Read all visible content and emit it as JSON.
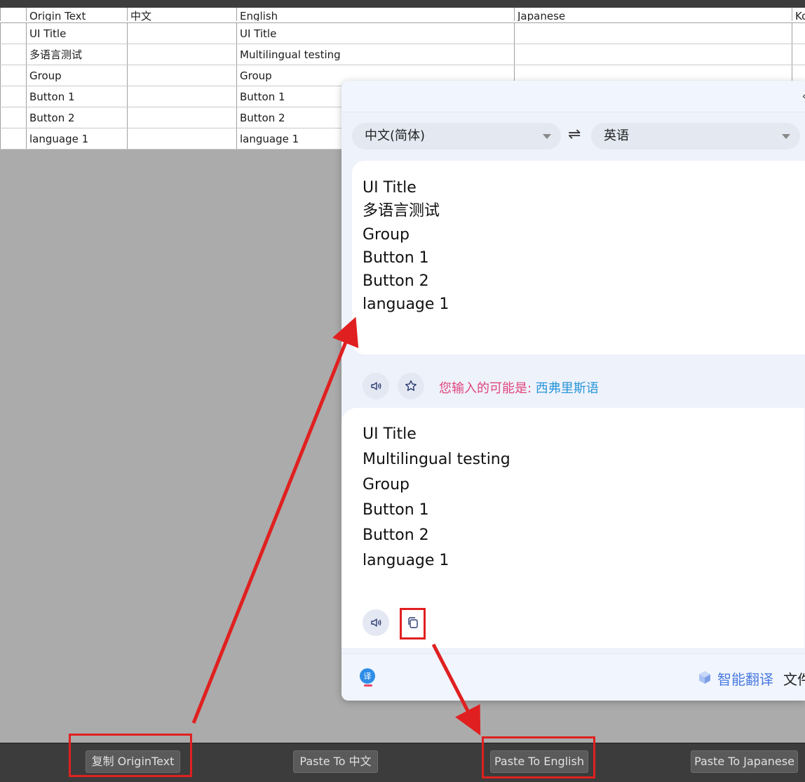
{
  "grid": {
    "headers": [
      "",
      "Origin Text",
      "中文",
      "English",
      "Japanese",
      "Ko"
    ],
    "rows": [
      [
        "",
        "UI Title",
        "",
        "UI Title",
        "",
        ""
      ],
      [
        "",
        "多语言测试",
        "",
        "Multilingual testing",
        "",
        ""
      ],
      [
        "",
        "Group",
        "",
        "Group",
        "",
        ""
      ],
      [
        "",
        "Button 1",
        "",
        "Button 1",
        "",
        ""
      ],
      [
        "",
        "Button 2",
        "",
        "Button 2",
        "",
        ""
      ],
      [
        "",
        "language 1",
        "",
        "language 1",
        "",
        ""
      ]
    ]
  },
  "translator": {
    "close_glyph": "‹",
    "source_lang": "中文(简体)",
    "swap_glyph": "⇌",
    "target_lang": "英语",
    "source_lines": [
      "UI Title",
      "多语言测试",
      "Group",
      "Button 1",
      "Button 2",
      "language 1"
    ],
    "hint_prefix": "您输入的可能是: ",
    "hint_link": "西弗里斯语",
    "target_lines": [
      "UI Title",
      "Multilingual testing",
      "Group",
      "Button 1",
      "Button 2",
      "language 1"
    ],
    "footer_smart": "智能翻译",
    "footer_doc": "文件",
    "colors": {
      "hint": "#e0457b",
      "link": "#2a97d8",
      "smart": "#4a7be0"
    },
    "icons": [
      "speaker-icon",
      "star-icon",
      "copy-icon",
      "translator-logo-icon",
      "cube-icon"
    ]
  },
  "bottom_bar": {
    "copy_origin": "复制 OriginText",
    "paste_zh": "Paste To 中文",
    "paste_en": "Paste To English",
    "paste_ja": "Paste To Japanese"
  },
  "annotation_color": "#e02020"
}
